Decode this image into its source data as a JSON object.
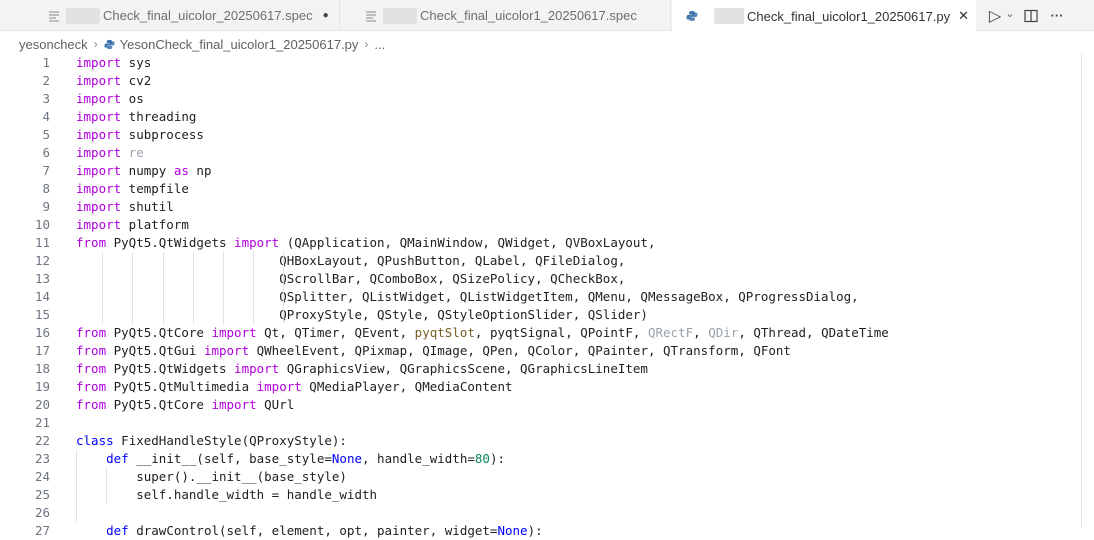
{
  "tabs": [
    {
      "label": "Check_final_uicolor_20250617.spec",
      "status": "●"
    },
    {
      "label": "Check_final_uicolor1_20250617.spec",
      "status": ""
    },
    {
      "label": "Check_final_uicolor1_20250617.py",
      "status": "✕"
    }
  ],
  "icons": {
    "spec": "file-lines-icon",
    "py": "python-icon",
    "run": "play-icon",
    "split": "split-editor-icon",
    "more": "more-icon"
  },
  "controls": {
    "run_glyph": "▷",
    "chevron_glyph": "⌄",
    "more_glyph": "···"
  },
  "breadcrumb": {
    "folder": "yesoncheck",
    "file": "YesonCheck_final_uicolor1_20250617.py",
    "more": "..."
  },
  "code_lines": [
    {
      "n": "1",
      "segs": [
        {
          "t": "import",
          "c": "kw"
        },
        {
          "t": " sys",
          "c": ""
        }
      ]
    },
    {
      "n": "2",
      "segs": [
        {
          "t": "import",
          "c": "kw"
        },
        {
          "t": " cv2",
          "c": ""
        }
      ]
    },
    {
      "n": "3",
      "segs": [
        {
          "t": "import",
          "c": "kw"
        },
        {
          "t": " os",
          "c": ""
        }
      ]
    },
    {
      "n": "4",
      "segs": [
        {
          "t": "import",
          "c": "kw"
        },
        {
          "t": " threading",
          "c": ""
        }
      ]
    },
    {
      "n": "5",
      "segs": [
        {
          "t": "import",
          "c": "kw"
        },
        {
          "t": " subprocess",
          "c": ""
        }
      ]
    },
    {
      "n": "6",
      "segs": [
        {
          "t": "import",
          "c": "kw"
        },
        {
          "t": " re",
          "c": "dim"
        }
      ]
    },
    {
      "n": "7",
      "segs": [
        {
          "t": "import",
          "c": "kw"
        },
        {
          "t": " numpy ",
          "c": ""
        },
        {
          "t": "as",
          "c": "kw"
        },
        {
          "t": " np",
          "c": ""
        }
      ]
    },
    {
      "n": "8",
      "segs": [
        {
          "t": "import",
          "c": "kw"
        },
        {
          "t": " tempfile",
          "c": ""
        }
      ]
    },
    {
      "n": "9",
      "segs": [
        {
          "t": "import",
          "c": "kw"
        },
        {
          "t": " shutil",
          "c": ""
        }
      ]
    },
    {
      "n": "10",
      "segs": [
        {
          "t": "import",
          "c": "kw"
        },
        {
          "t": " platform",
          "c": ""
        }
      ]
    },
    {
      "n": "11",
      "segs": [
        {
          "t": "from",
          "c": "kw"
        },
        {
          "t": " PyQt5.QtWidgets ",
          "c": ""
        },
        {
          "t": "import",
          "c": "kw"
        },
        {
          "t": " (QApplication, QMainWindow, QWidget, QVBoxLayout,",
          "c": ""
        }
      ]
    },
    {
      "n": "12",
      "segs": [
        {
          "t": "                           QHBoxLayout, QPushButton, QLabel, QFileDialog,",
          "c": ""
        }
      ]
    },
    {
      "n": "13",
      "segs": [
        {
          "t": "                           QScrollBar, QComboBox, QSizePolicy, QCheckBox,",
          "c": ""
        }
      ]
    },
    {
      "n": "14",
      "segs": [
        {
          "t": "                           QSplitter, QListWidget, QListWidgetItem, QMenu, QMessageBox, QProgressDialog,",
          "c": ""
        }
      ]
    },
    {
      "n": "15",
      "segs": [
        {
          "t": "                           QProxyStyle, QStyle, QStyleOptionSlider, QSlider)",
          "c": ""
        }
      ]
    },
    {
      "n": "16",
      "segs": [
        {
          "t": "from",
          "c": "kw"
        },
        {
          "t": " PyQt5.QtCore ",
          "c": ""
        },
        {
          "t": "import",
          "c": "kw"
        },
        {
          "t": " Qt, QTimer, QEvent, ",
          "c": ""
        },
        {
          "t": "pyqtSlot",
          "c": "fn"
        },
        {
          "t": ", pyqtSignal, QPointF, ",
          "c": ""
        },
        {
          "t": "QRectF",
          "c": "dim"
        },
        {
          "t": ", ",
          "c": ""
        },
        {
          "t": "QDir",
          "c": "dim"
        },
        {
          "t": ", QThread, QDateTime",
          "c": ""
        }
      ]
    },
    {
      "n": "17",
      "segs": [
        {
          "t": "from",
          "c": "kw"
        },
        {
          "t": " PyQt5.QtGui ",
          "c": ""
        },
        {
          "t": "import",
          "c": "kw"
        },
        {
          "t": " QWheelEvent, QPixmap, QImage, QPen, QColor, QPainter, QTransform, QFont",
          "c": ""
        }
      ]
    },
    {
      "n": "18",
      "segs": [
        {
          "t": "from",
          "c": "kw"
        },
        {
          "t": " PyQt5.QtWidgets ",
          "c": ""
        },
        {
          "t": "import",
          "c": "kw"
        },
        {
          "t": " QGraphicsView, QGraphicsScene, QGraphicsLineItem",
          "c": ""
        }
      ]
    },
    {
      "n": "19",
      "segs": [
        {
          "t": "from",
          "c": "kw"
        },
        {
          "t": " PyQt5.QtMultimedia ",
          "c": ""
        },
        {
          "t": "import",
          "c": "kw"
        },
        {
          "t": " QMediaPlayer, QMediaContent",
          "c": ""
        }
      ]
    },
    {
      "n": "20",
      "segs": [
        {
          "t": "from",
          "c": "kw"
        },
        {
          "t": " PyQt5.QtCore ",
          "c": ""
        },
        {
          "t": "import",
          "c": "kw"
        },
        {
          "t": " QUrl",
          "c": ""
        }
      ]
    },
    {
      "n": "21",
      "segs": []
    },
    {
      "n": "22",
      "segs": [
        {
          "t": "class",
          "c": "blue"
        },
        {
          "t": " FixedHandleStyle(QProxyStyle):",
          "c": ""
        }
      ]
    },
    {
      "n": "23",
      "segs": [
        {
          "t": "    ",
          "c": ""
        },
        {
          "t": "def",
          "c": "blue"
        },
        {
          "t": " __init__(self, base_style=",
          "c": ""
        },
        {
          "t": "None",
          "c": "blue"
        },
        {
          "t": ", handle_width=",
          "c": ""
        },
        {
          "t": "80",
          "c": "num"
        },
        {
          "t": "):",
          "c": ""
        }
      ]
    },
    {
      "n": "24",
      "segs": [
        {
          "t": "        super().__init__(base_style)",
          "c": ""
        }
      ]
    },
    {
      "n": "25",
      "segs": [
        {
          "t": "        self.handle_width = handle_width",
          "c": ""
        }
      ]
    },
    {
      "n": "26",
      "segs": []
    },
    {
      "n": "27",
      "segs": [
        {
          "t": "    ",
          "c": ""
        },
        {
          "t": "def",
          "c": "blue"
        },
        {
          "t": " drawControl(self, element, opt, painter, widget=",
          "c": ""
        },
        {
          "t": "None",
          "c": "blue"
        },
        {
          "t": "):",
          "c": ""
        }
      ]
    }
  ]
}
